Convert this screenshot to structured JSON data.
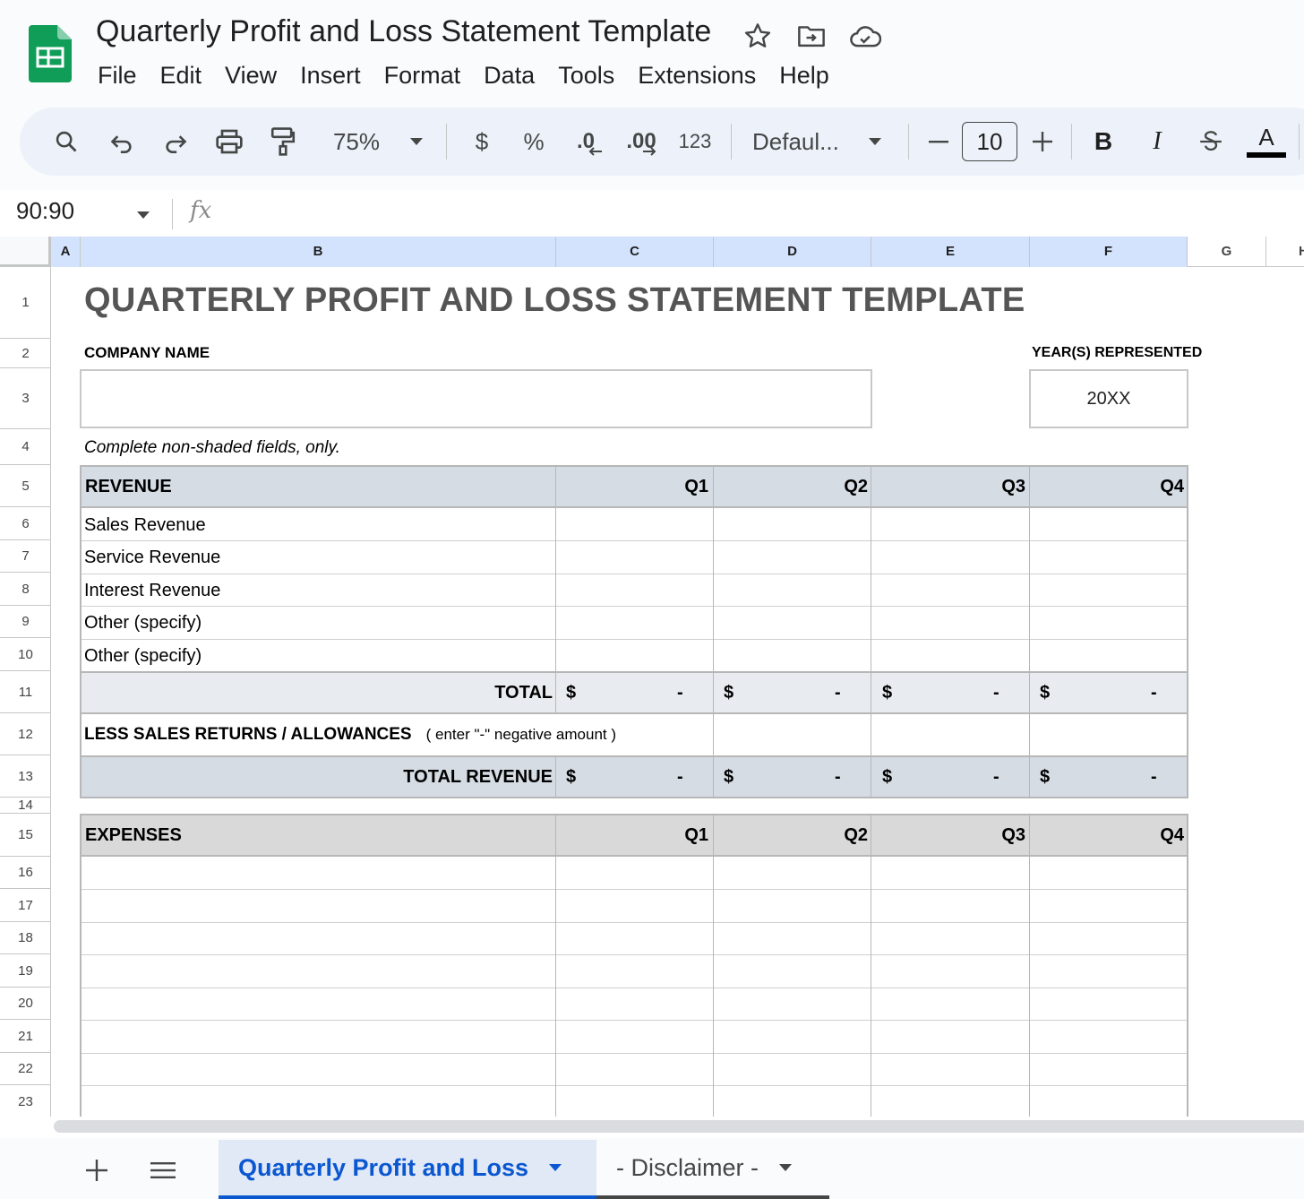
{
  "app": {
    "doc_title": "Quarterly Profit and Loss Statement Template",
    "menu": [
      "File",
      "Edit",
      "View",
      "Insert",
      "Format",
      "Data",
      "Tools",
      "Extensions",
      "Help"
    ]
  },
  "toolbar": {
    "zoom": "75%",
    "currency": "$",
    "percent": "%",
    "dec_decrease": ".0",
    "dec_increase": ".00",
    "number_format": "123",
    "font": "Defaul...",
    "font_size": "10",
    "bold": "B",
    "italic": "I",
    "text_color": "A"
  },
  "formula_bar": {
    "name_box": "90:90",
    "fx": "fx",
    "formula": ""
  },
  "grid": {
    "columns": [
      "A",
      "B",
      "C",
      "D",
      "E",
      "F",
      "G",
      "H"
    ],
    "rows": [
      "1",
      "2",
      "3",
      "4",
      "5",
      "6",
      "7",
      "8",
      "9",
      "10",
      "11",
      "12",
      "13",
      "14",
      "15",
      "16",
      "17",
      "18",
      "19",
      "20",
      "21",
      "22",
      "23"
    ]
  },
  "sheet": {
    "title": "QUARTERLY PROFIT AND LOSS STATEMENT TEMPLATE",
    "company_label": "COMPANY NAME",
    "company_value": "",
    "years_label": "YEAR(S) REPRESENTED",
    "years_value": "20XX",
    "note": "Complete non-shaded fields, only.",
    "revenue": {
      "header": "REVENUE",
      "quarters": [
        "Q1",
        "Q2",
        "Q3",
        "Q4"
      ],
      "items": [
        "Sales Revenue",
        "Service Revenue",
        "Interest Revenue",
        "Other (specify)",
        "Other (specify)"
      ],
      "total_label": "TOTAL",
      "returns_label": "LESS SALES RETURNS / ALLOWANCES",
      "returns_hint": "( enter \"-\" negative amount )",
      "total_revenue_label": "TOTAL REVENUE",
      "currency": "$",
      "dash": "-"
    },
    "expenses": {
      "header": "EXPENSES",
      "quarters": [
        "Q1",
        "Q2",
        "Q3",
        "Q4"
      ]
    }
  },
  "tabs": {
    "active": "Quarterly Profit and Loss",
    "other": "- Disclaimer -"
  },
  "colors": {
    "accent": "#0b57d0",
    "sheets_green": "#0f9d58",
    "header_fill": "#d5dce4",
    "expense_header_fill": "#d9d9d9"
  }
}
